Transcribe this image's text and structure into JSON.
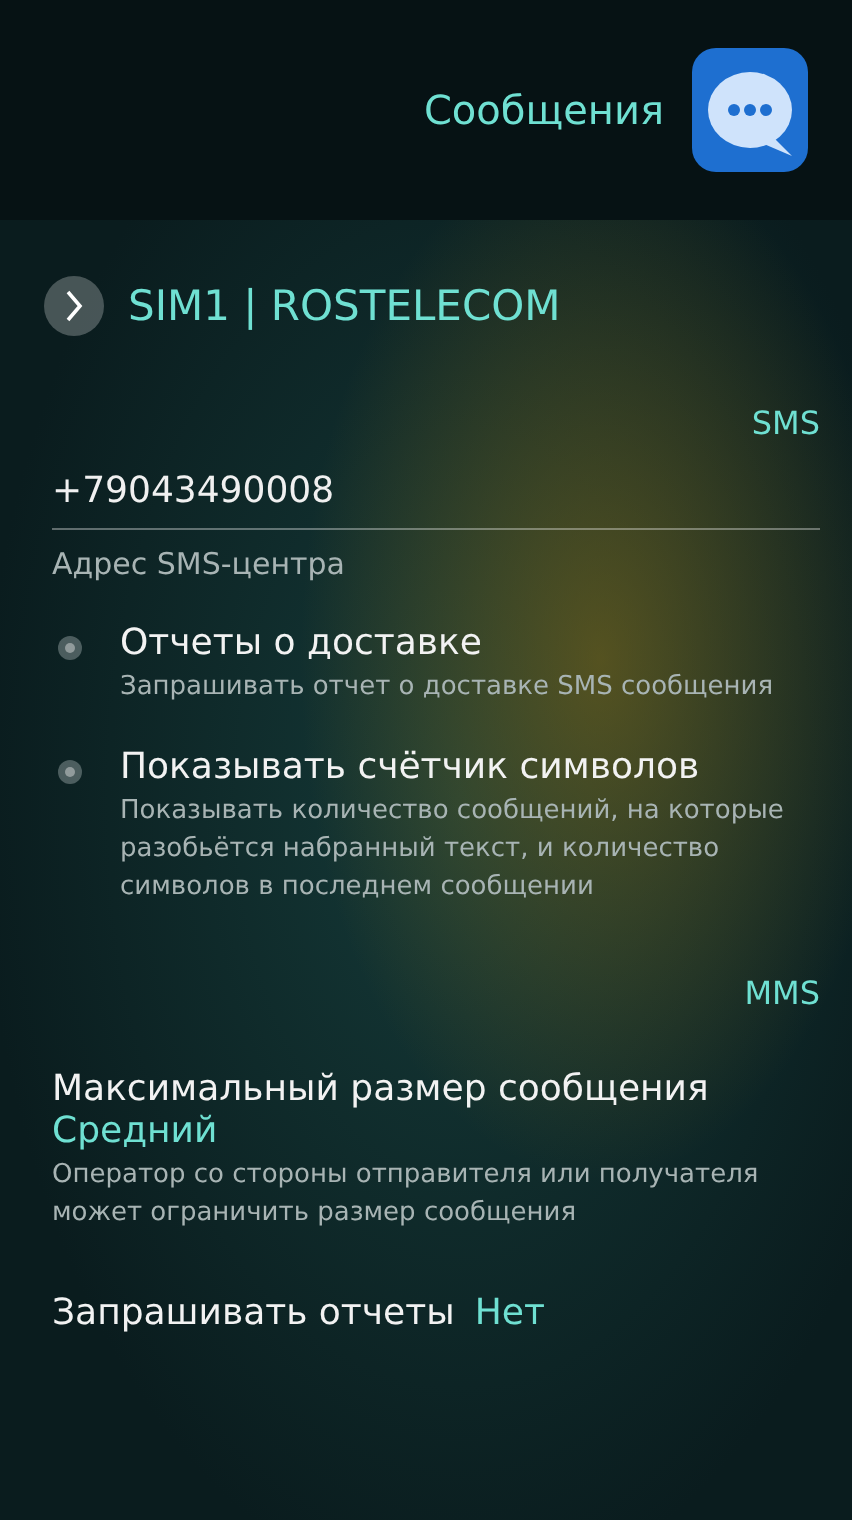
{
  "header": {
    "title": "Сообщения"
  },
  "sim": {
    "label": "SIM1 | ROSTELECOM"
  },
  "sections": [
    {
      "title": "SMS",
      "items": [
        {
          "kind": "field",
          "value": "+79043490008",
          "label": "Адрес SMS-центра"
        },
        {
          "kind": "toggle",
          "title": "Отчеты о доставке",
          "description": "Запрашивать отчет о доставке SMS сообщения",
          "checked": false
        },
        {
          "kind": "toggle",
          "title": "Показывать счётчик символов",
          "description": "Показывать количество сообщений, на которые разобьётся набранный текст, и количество символов в последнем сообщении",
          "checked": false
        }
      ]
    },
    {
      "title": "MMS",
      "items": [
        {
          "kind": "choice",
          "title": "Максимальный размер сообщения",
          "value": "Средний",
          "description": "Оператор со стороны отправителя или получателя может ограничить размер сообщения"
        },
        {
          "kind": "inline",
          "title": "Запрашивать отчеты",
          "value": "Нет"
        }
      ]
    }
  ]
}
